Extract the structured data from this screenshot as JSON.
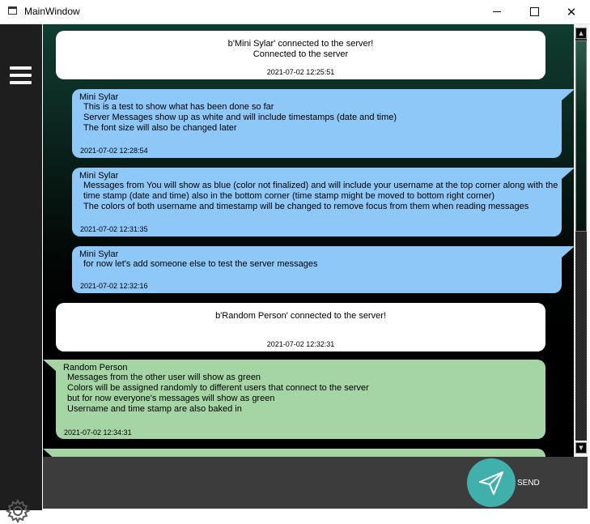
{
  "window": {
    "title": "MainWindow",
    "minimize_icon": "minimize-icon",
    "maximize_icon": "maximize-icon",
    "close_glyph": "✕"
  },
  "sidebar": {
    "menu_icon": "hamburger-menu-icon",
    "settings_icon": "gear-icon"
  },
  "messages": [
    {
      "type": "server",
      "lines": [
        "b'Mini Sylar' connected to the server!",
        "Connected to the server"
      ],
      "timestamp": "2021-07-02 12:25:51"
    },
    {
      "type": "self",
      "user": "Mini Sylar",
      "lines": [
        "This is a test to show what has been done so far",
        "Server Messages show up as white and will include timestamps (date and time)",
        "The font size will also be changed later"
      ],
      "timestamp": "2021-07-02 12:28:54"
    },
    {
      "type": "self",
      "user": "Mini Sylar",
      "lines": [
        "Messages from You will show as blue (color not finalized) and will include your username at the top corner along with the",
        "time stamp (date and time) also in the bottom corner (time stamp might be moved to bottom right corner)",
        "The colors of both username and timestamp will be changed to remove focus from them when reading messages"
      ],
      "timestamp": "2021-07-02 12:31:35"
    },
    {
      "type": "self",
      "user": "Mini Sylar",
      "lines": [
        "for now let's add someone else to test the server messages"
      ],
      "timestamp": "2021-07-02 12:32:16"
    },
    {
      "type": "server",
      "lines": [
        "b'Random Person' connected to the server!"
      ],
      "timestamp": "2021-07-02 12:32:31"
    },
    {
      "type": "other",
      "user": "Random Person",
      "lines": [
        "Messages from the other user will show as green",
        "Colors will be assigned randomly to different users that connect to the server",
        "but for now everyone's messages will show as green",
        "Username and time stamp are also baked in"
      ],
      "timestamp": "2021-07-02 12:34:31"
    }
  ],
  "scrollbar": {
    "up_glyph": "▲",
    "down_glyph": "▼"
  },
  "composer": {
    "send_label": "SEND",
    "send_icon": "send-paper-plane-icon"
  },
  "colors": {
    "server_bubble": "#ffffff",
    "self_bubble": "#8ec8f8",
    "other_bubble": "#a5d5a4",
    "send_button": "#3fb0ac",
    "sidebar": "#1e1e1e",
    "input_area": "#3c3c3c"
  }
}
